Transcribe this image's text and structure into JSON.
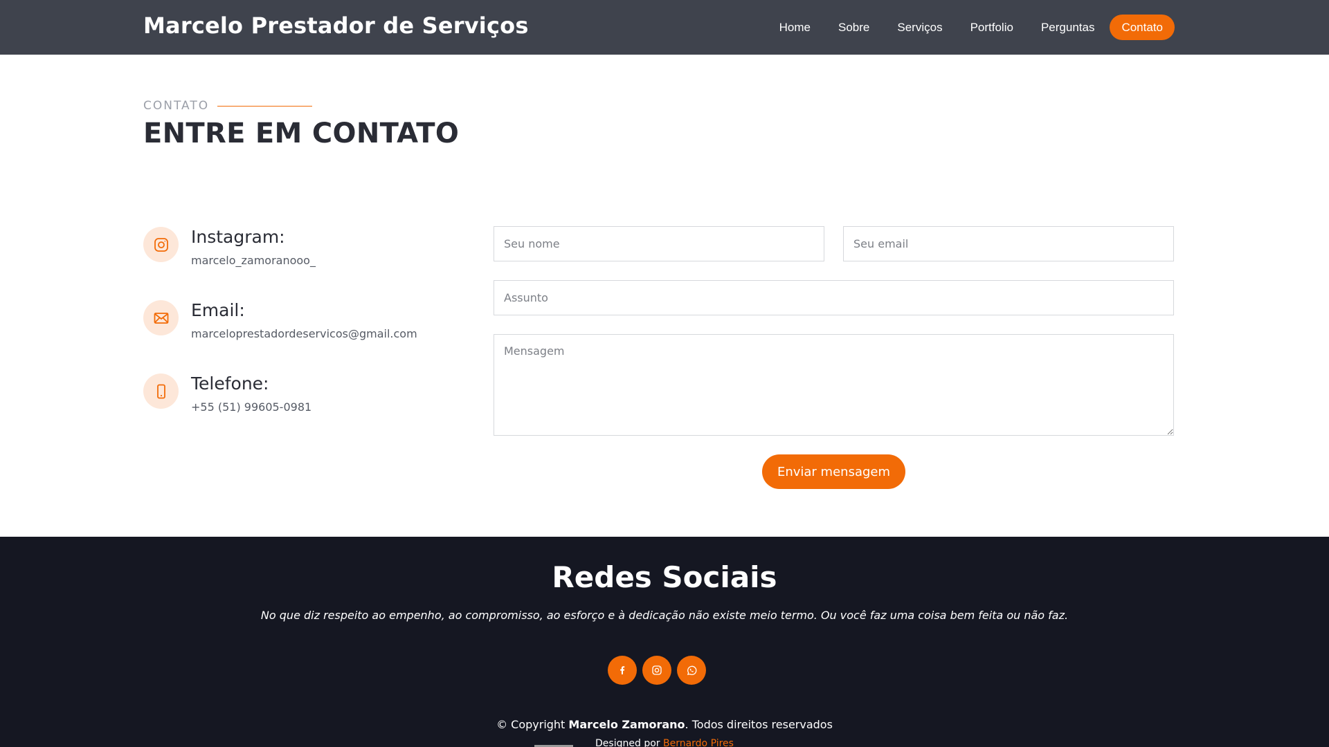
{
  "header": {
    "brand": "Marcelo Prestador de Serviços",
    "nav": [
      "Home",
      "Sobre",
      "Serviços",
      "Portfolio",
      "Perguntas",
      "Contato"
    ],
    "active": "Contato"
  },
  "section": {
    "eyebrow": "CONTATO",
    "title": "ENTRE EM CONTATO"
  },
  "info": [
    {
      "label": "Instagram:",
      "value": "marcelo_zamoranooo_",
      "icon": "instagram-icon"
    },
    {
      "label": "Email:",
      "value": "marceloprestadordeservicos@gmail.com",
      "icon": "envelope-icon"
    },
    {
      "label": "Telefone:",
      "value": "+55 (51) 99605-0981",
      "icon": "phone-icon"
    }
  ],
  "form": {
    "name_placeholder": "Seu nome",
    "email_placeholder": "Seu email",
    "subject_placeholder": "Assunto",
    "message_placeholder": "Mensagem",
    "submit_label": "Enviar mensagem"
  },
  "footer": {
    "title": "Redes Sociais",
    "quote": "No que diz respeito ao empenho, ao compromisso, ao esforço e à dedicação não existe meio termo. Ou você faz uma coisa bem feita ou não faz.",
    "socials": [
      "facebook-icon",
      "instagram-icon",
      "whatsapp-icon"
    ],
    "copyright_prefix": "© Copyright",
    "copyright_name": "Marcelo Zamorano",
    "copyright_suffix": ". Todos direitos reservados",
    "designed_prefix": "Designed por",
    "designer": "Bernardo Pires"
  },
  "colors": {
    "accent": "#f26b07",
    "header_bg": "#3f434d",
    "footer_bg": "#151722"
  }
}
